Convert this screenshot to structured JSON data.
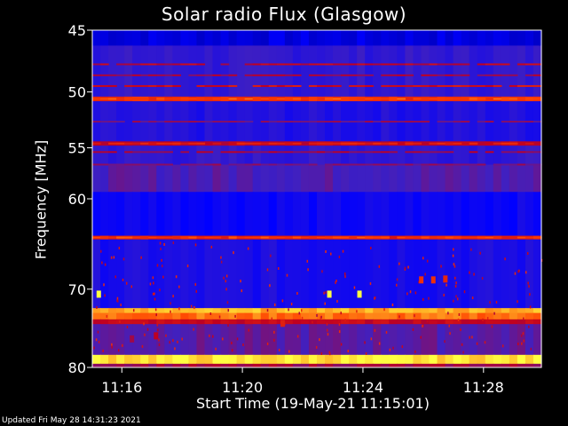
{
  "chart_data": {
    "type": "heatmap",
    "title": "Solar radio Flux (Glasgow)",
    "ylabel": "Frequency [MHz]",
    "xlabel": "Start Time (19-May-21 11:15:01)",
    "y_ticks": [
      "45",
      "50",
      "55",
      "60",
      "70",
      "80"
    ],
    "y_tick_values": [
      45,
      50,
      55,
      60,
      70,
      80
    ],
    "x_ticks": [
      "11:16",
      "11:20",
      "11:24",
      "11:28"
    ],
    "x_tick_minutes": [
      0.98,
      4.98,
      8.98,
      12.98
    ],
    "x_range_minutes": [
      0,
      14.9
    ],
    "y_range_mhz": [
      45,
      80
    ],
    "y_scale": "log",
    "colormap": [
      "#000080",
      "#0000ff",
      "#4020c0",
      "#c00020",
      "#ff4000",
      "#ffff40"
    ],
    "bands": [
      {
        "from": 45,
        "to": 46.2,
        "level": 0.15
      },
      {
        "from": 46.2,
        "to": 50.4,
        "level": 0.35
      },
      {
        "from": 50.4,
        "to": 50.8,
        "level": 0.75
      },
      {
        "from": 50.8,
        "to": 54.4,
        "level": 0.3
      },
      {
        "from": 54.4,
        "to": 54.8,
        "level": 0.6
      },
      {
        "from": 54.8,
        "to": 56.6,
        "level": 0.35
      },
      {
        "from": 56.6,
        "to": 59.3,
        "level": 0.42
      },
      {
        "from": 59.3,
        "to": 63.9,
        "level": 0.24
      },
      {
        "from": 63.9,
        "to": 64.3,
        "level": 0.7
      },
      {
        "from": 64.3,
        "to": 72.3,
        "level": 0.28
      },
      {
        "from": 72.3,
        "to": 72.9,
        "level": 0.92
      },
      {
        "from": 72.9,
        "to": 73.7,
        "level": 0.85
      },
      {
        "from": 73.7,
        "to": 74.3,
        "level": 0.62
      },
      {
        "from": 74.3,
        "to": 78.3,
        "level": 0.44
      },
      {
        "from": 78.3,
        "to": 79.5,
        "level": 0.97
      },
      {
        "from": 79.5,
        "to": 80,
        "level": 0.55
      }
    ],
    "lines": [
      {
        "mhz": 47.7,
        "level": 0.6
      },
      {
        "mhz": 48.6,
        "level": 0.55
      },
      {
        "mhz": 49.5,
        "level": 0.65
      },
      {
        "mhz": 50.6,
        "level": 0.8
      },
      {
        "mhz": 52.6,
        "level": 0.5
      },
      {
        "mhz": 54.6,
        "level": 0.7
      },
      {
        "mhz": 55.4,
        "level": 0.55
      },
      {
        "mhz": 56.6,
        "level": 0.5
      },
      {
        "mhz": 64.1,
        "level": 0.78
      }
    ],
    "bursts": [
      {
        "t": 0.2,
        "mhz": 70.6,
        "level": 1.0
      },
      {
        "t": 7.85,
        "mhz": 70.6,
        "level": 1.0
      },
      {
        "t": 8.85,
        "mhz": 70.6,
        "level": 1.0
      },
      {
        "t": 10.9,
        "mhz": 68.9,
        "level": 0.75
      },
      {
        "t": 11.3,
        "mhz": 68.9,
        "level": 0.75
      },
      {
        "t": 11.7,
        "mhz": 68.8,
        "level": 0.72
      },
      {
        "t": 6.3,
        "mhz": 74.2,
        "level": 0.7
      },
      {
        "t": 2.1,
        "mhz": 75.8,
        "level": 0.6
      },
      {
        "t": 1.3,
        "mhz": 76.2,
        "level": 0.55
      }
    ]
  },
  "footer": "Updated Fri May 28 14:31:23 2021"
}
